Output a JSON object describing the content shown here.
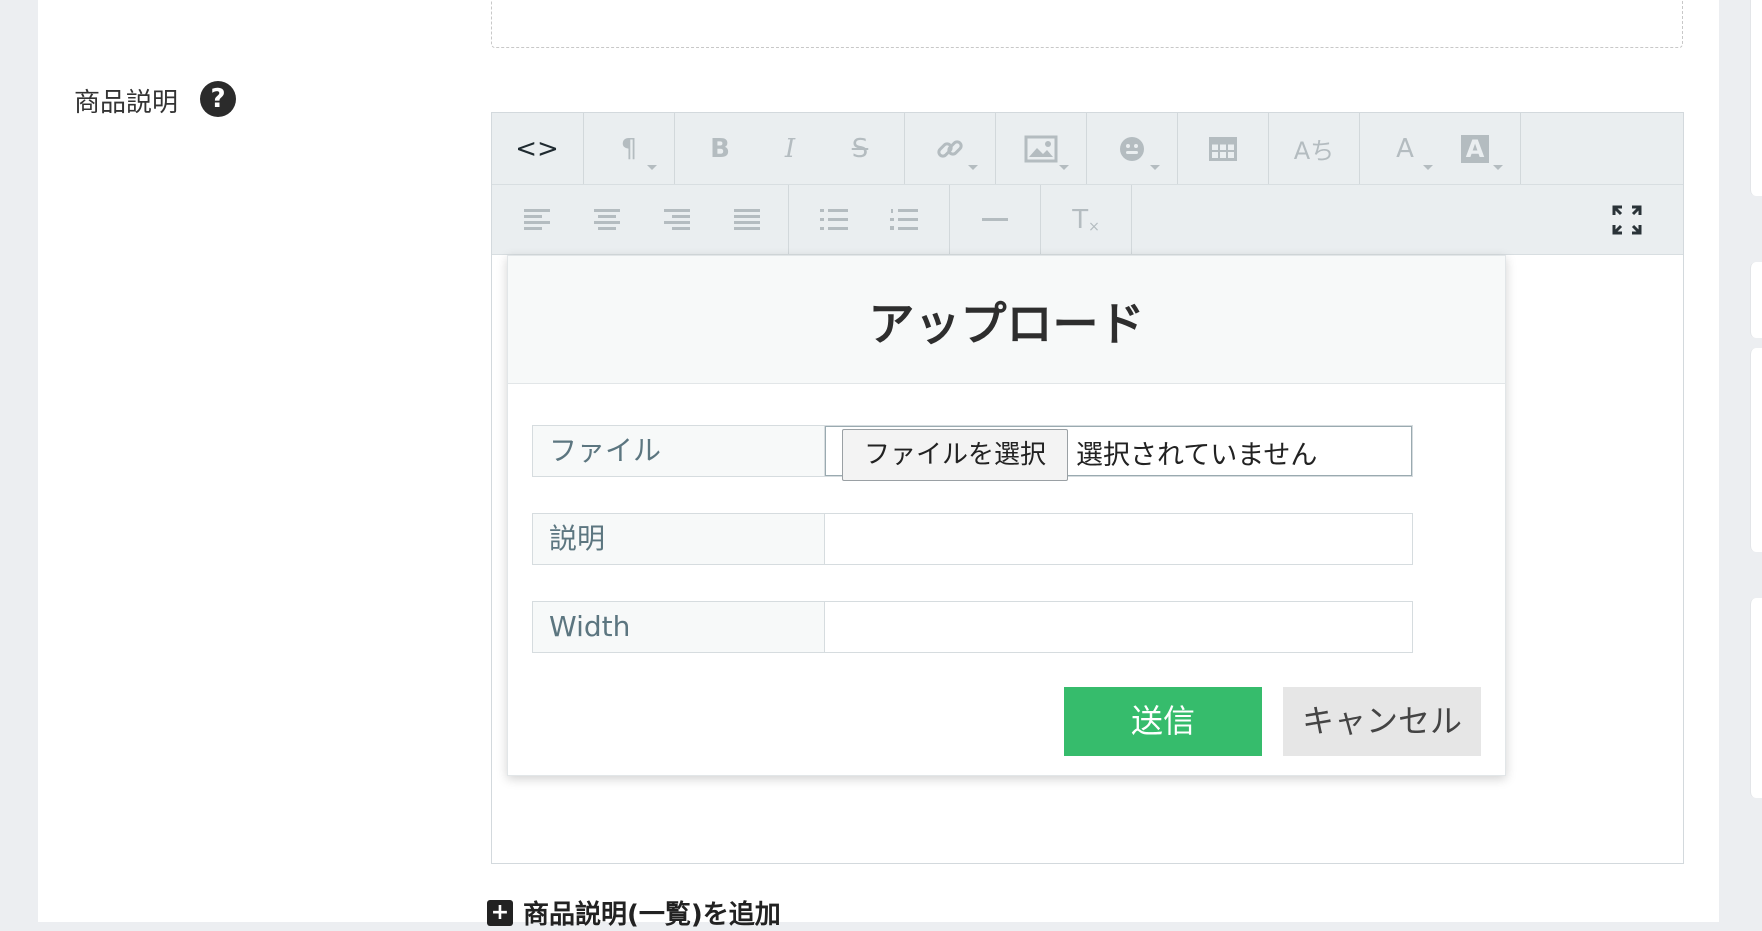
{
  "field": {
    "label": "商品説明",
    "help_glyph": "?"
  },
  "toolbar": {
    "row1": [
      {
        "name": "code-view-icon",
        "glyph": "<>",
        "active": true
      },
      {
        "name": "paragraph-format-icon",
        "glyph": "¶",
        "dropdown": true
      },
      {
        "name": "bold-icon",
        "glyph": "B"
      },
      {
        "name": "italic-icon",
        "glyph": "I"
      },
      {
        "name": "strikethrough-icon",
        "glyph": "S"
      },
      {
        "name": "link-icon",
        "glyph": "🔗",
        "dropdown": true
      },
      {
        "name": "image-icon",
        "glyph": "🖼",
        "dropdown": true
      },
      {
        "name": "emoticon-icon",
        "glyph": "☻",
        "dropdown": true
      },
      {
        "name": "table-icon",
        "glyph": "▦"
      },
      {
        "name": "ruby-icon",
        "glyph": "Aち"
      },
      {
        "name": "font-color-icon",
        "glyph": "A",
        "dropdown": true
      },
      {
        "name": "background-color-icon",
        "glyph": "A",
        "dropdown": true
      }
    ],
    "row2": [
      {
        "name": "align-left-icon"
      },
      {
        "name": "align-center-icon"
      },
      {
        "name": "align-right-icon"
      },
      {
        "name": "align-justify-icon"
      },
      {
        "name": "bullet-list-icon"
      },
      {
        "name": "numbered-list-icon"
      },
      {
        "name": "horizontal-rule-icon"
      },
      {
        "name": "clear-format-icon",
        "glyph": "T"
      },
      {
        "name": "fullscreen-icon"
      }
    ]
  },
  "modal": {
    "title": "アップロード",
    "file_label": "ファイル",
    "file_button": "ファイルを選択",
    "file_status": "選択されていません",
    "description_label": "説明",
    "description_value": "",
    "width_label": "Width",
    "width_value": "",
    "submit": "送信",
    "cancel": "キャンセル"
  },
  "footer": {
    "add_link": "商品説明(一覧)を追加"
  },
  "colors": {
    "submit_green": "#36bc6c",
    "toolbar_bg": "#eaeef0",
    "page_bg": "#eceef1"
  }
}
